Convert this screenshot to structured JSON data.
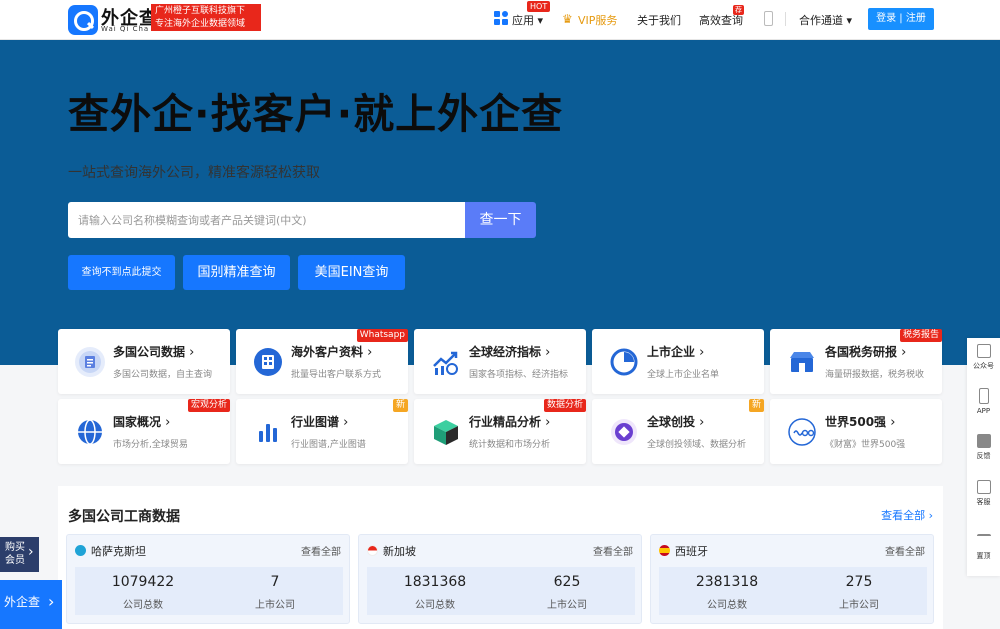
{
  "header": {
    "logo_cn": "外企查",
    "logo_en": "Wai Qi Cha",
    "slogan_line1": "广州橙子互联科技旗下",
    "slogan_line2": "专注海外企业数据领域",
    "nav": {
      "apps": "应用",
      "hot": "HOT",
      "vip": "VIP服务",
      "about": "关于我们",
      "efficient": "高效查询",
      "new": "荐",
      "partner": "合作通道"
    },
    "login": "登录 | 注册"
  },
  "hero": {
    "title": "查外企·找客户·就上外企查",
    "subtitle": "一站式查询海外公司，精准客源轻松获取",
    "search_placeholder": "请输入公司名称模糊查询或者产品关键词(中文)",
    "search_button": "查一下",
    "buttons": [
      "查询不到点此提交",
      "国别精准查询",
      "美国EIN查询"
    ]
  },
  "categories": [
    {
      "title": "多国公司数据",
      "desc": "多国公司数据，自主查询",
      "badge": "",
      "icon": "company-data-icon"
    },
    {
      "title": "海外客户资料",
      "desc": "批量导出客户联系方式",
      "badge": "Whatsapp",
      "icon": "customer-data-icon"
    },
    {
      "title": "全球经济指标",
      "desc": "国家各项指标、经济指标",
      "badge": "",
      "icon": "economy-icon"
    },
    {
      "title": "上市企业",
      "desc": "全球上市企业名单",
      "badge": "",
      "icon": "listed-company-icon"
    },
    {
      "title": "各国税务研报",
      "desc": "海量研报数据，税务税收",
      "badge": "税务报告",
      "icon": "tax-report-icon"
    },
    {
      "title": "国家概况",
      "desc": "市场分析,全球贸易",
      "badge": "宏观分析",
      "icon": "globe-icon"
    },
    {
      "title": "行业图谱",
      "desc": "行业图谱,产业图谱",
      "badge": "新",
      "icon": "bar-chart-icon"
    },
    {
      "title": "行业精品分析",
      "desc": "统计数据和市场分析",
      "badge": "数据分析",
      "icon": "cube-icon"
    },
    {
      "title": "全球创投",
      "desc": "全球创投领域、数据分析",
      "badge": "新",
      "icon": "venture-icon"
    },
    {
      "title": "世界500强",
      "desc": "《财富》世界500强",
      "badge": "",
      "icon": "fortune-500-icon"
    }
  ],
  "data_section": {
    "title": "多国公司工商数据",
    "see_all": "查看全部",
    "countries": [
      {
        "name": "哈萨克斯坦",
        "more": "查看全部",
        "total": "1079422",
        "total_label": "公司总数",
        "listed": "7",
        "listed_label": "上市公司",
        "flag_color": "#1fa3d6"
      },
      {
        "name": "新加坡",
        "more": "查看全部",
        "total": "1831368",
        "total_label": "公司总数",
        "listed": "625",
        "listed_label": "上市公司",
        "flag_color": "#e8271b"
      },
      {
        "name": "西班牙",
        "more": "查看全部",
        "total": "2381318",
        "total_label": "公司总数",
        "listed": "275",
        "listed_label": "上市公司",
        "flag_color": "#e8b10e"
      }
    ]
  },
  "float_bar": [
    "公众号",
    "APP",
    "反馈",
    "客服",
    "置顶"
  ],
  "left_float": {
    "buy_vip_1": "购买",
    "buy_vip_2": "会员",
    "wqc_tab": "外企查"
  }
}
